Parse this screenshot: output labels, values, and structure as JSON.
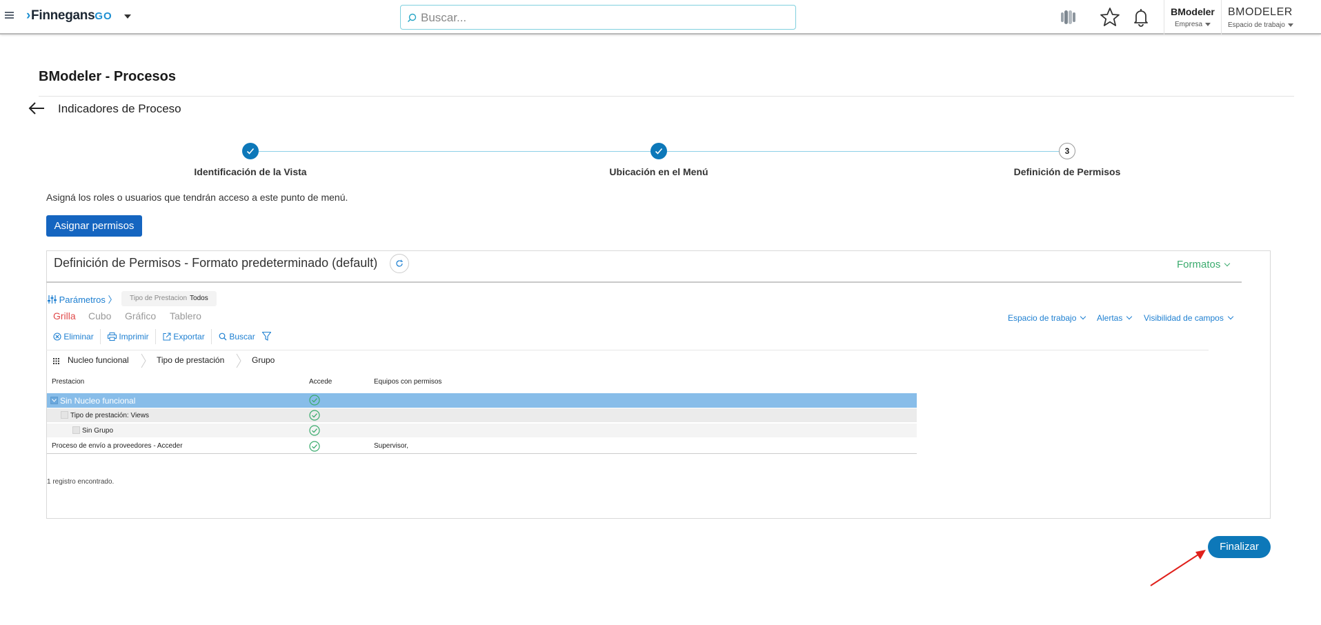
{
  "topbar": {
    "logo_prefix": "›",
    "logo_text": "Finnegans",
    "logo_suffix": "GO",
    "search_placeholder": "Buscar...",
    "user_company_name": "BModeler",
    "user_company_label": "Empresa",
    "workspace_name": "BMODELER",
    "workspace_label": "Espacio de trabajo"
  },
  "page": {
    "title": "BModeler - Procesos",
    "subtitle": "Indicadores de Proceso",
    "description": "Asigná los roles o usuarios que tendrán acceso a este punto de menú.",
    "assign_button": "Asignar permisos",
    "finish_button": "Finalizar"
  },
  "stepper": {
    "steps": [
      {
        "label": "Identificación de la Vista",
        "state": "done"
      },
      {
        "label": "Ubicación en el Menú",
        "state": "done"
      },
      {
        "label": "Definición de Permisos",
        "state": "current",
        "number": "3"
      }
    ]
  },
  "panel": {
    "title": "Definición de Permisos - Formato predeterminado (default)",
    "formats_label": "Formatos",
    "params_label": "Parámetros",
    "param_chip_label": "Tipo de Prestacion",
    "param_chip_value": "Todos",
    "view_tabs": [
      "Grilla",
      "Cubo",
      "Gráfico",
      "Tablero"
    ],
    "active_tab": "Grilla",
    "right_menu": [
      "Espacio de trabajo",
      "Alertas",
      "Visibilidad de campos"
    ],
    "toolbar": [
      "Eliminar",
      "Imprimir",
      "Exportar",
      "Buscar"
    ],
    "grouping": [
      "Nucleo funcional",
      "Tipo de prestación",
      "Grupo"
    ],
    "columns": [
      "Prestacion",
      "Accede",
      "Equipos con permisos"
    ],
    "rows": [
      {
        "label": "Sin Nucleo funcional",
        "level": 0,
        "team": ""
      },
      {
        "label": "Tipo de prestación: Views",
        "level": 1,
        "team": ""
      },
      {
        "label": "Sin Grupo",
        "level": 2,
        "team": ""
      },
      {
        "label": "Proceso de envío a proveedores - Acceder",
        "level": 3,
        "team": "Supervisor,"
      }
    ],
    "records_found": "1 registro encontrado."
  },
  "colors": {
    "primary": "#0d78b9",
    "assign_button": "#1565c0",
    "link": "#1d7fd1",
    "active_tab": "#e04a4a",
    "formats": "#3aab6d",
    "selected_row": "#88bde9",
    "check": "#3aab6d",
    "annotation_arrow": "#e0201b"
  },
  "icons": [
    "hamburger-icon",
    "search-icon",
    "app-switch-icon",
    "star-icon",
    "bell-icon",
    "back-arrow-icon",
    "check-icon",
    "refresh-icon",
    "sliders-icon",
    "delete-icon",
    "print-icon",
    "export-icon",
    "filter-icon",
    "grip-icon",
    "check-circle-icon"
  ]
}
